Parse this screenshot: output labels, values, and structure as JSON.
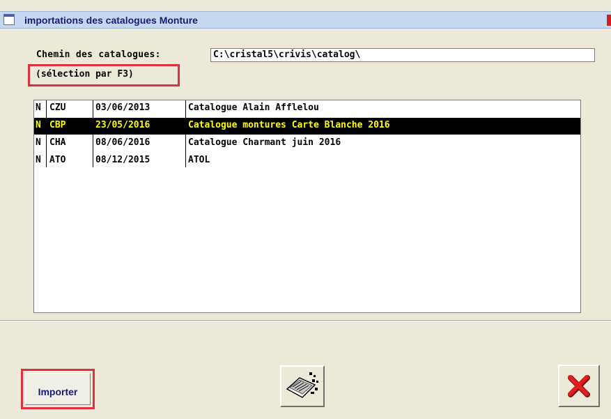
{
  "window": {
    "title": "importations des catalogues Monture"
  },
  "path": {
    "label": "Chemin des catalogues:",
    "value": "C:\\cristal5\\crivis\\catalog\\"
  },
  "hint": "(sélection par F3)",
  "catalogs": [
    {
      "flag": "N",
      "code": "CZU",
      "date": "03/06/2013",
      "name": "Catalogue Alain Afflelou",
      "selected": false
    },
    {
      "flag": "N",
      "code": "CBP",
      "date": "23/05/2016",
      "name": "Catalogue montures Carte Blanche 2016",
      "selected": true
    },
    {
      "flag": "N",
      "code": "CHA",
      "date": "08/06/2016",
      "name": "Catalogue Charmant juin 2016",
      "selected": false
    },
    {
      "flag": "N",
      "code": "ATO",
      "date": "08/12/2015",
      "name": "ATOL",
      "selected": false
    }
  ],
  "buttons": {
    "import_label": "Importer",
    "tool_icon": "catalog-tools-icon",
    "close_icon": "red-x-icon"
  },
  "colors": {
    "selection_bg": "#000000",
    "selection_fg": "#ffff00",
    "highlight_border": "#e03040",
    "close_red": "#e02020"
  }
}
